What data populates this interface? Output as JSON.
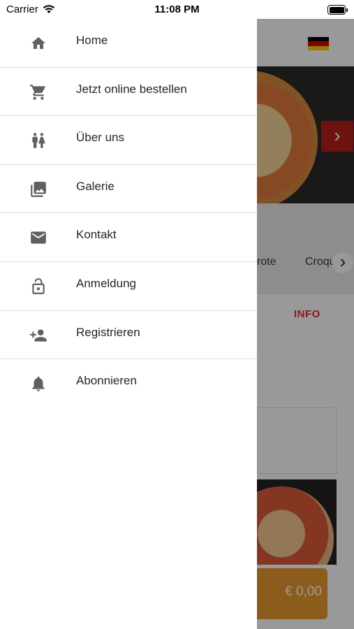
{
  "status_bar": {
    "carrier": "Carrier",
    "time": "11:08 PM"
  },
  "drawer": {
    "items": [
      {
        "label": "Home",
        "icon": "home-icon"
      },
      {
        "label": "Jetzt online bestellen",
        "icon": "cart-icon"
      },
      {
        "label": "Über uns",
        "icon": "people-icon"
      },
      {
        "label": "Galerie",
        "icon": "gallery-icon"
      },
      {
        "label": "Kontakt",
        "icon": "mail-icon"
      },
      {
        "label": "Anmeldung",
        "icon": "lock-icon"
      },
      {
        "label": "Registrieren",
        "icon": "add-user-icon"
      },
      {
        "label": "Abonnieren",
        "icon": "bell-icon"
      }
    ]
  },
  "background": {
    "categories": [
      "rote",
      "Croque"
    ],
    "info_tab": "INFO",
    "cart_total": "€ 0,00",
    "colors": {
      "accent_red": "#b5201b",
      "info_red": "#e0303a",
      "cart_orange": "#ea9a2f"
    }
  }
}
